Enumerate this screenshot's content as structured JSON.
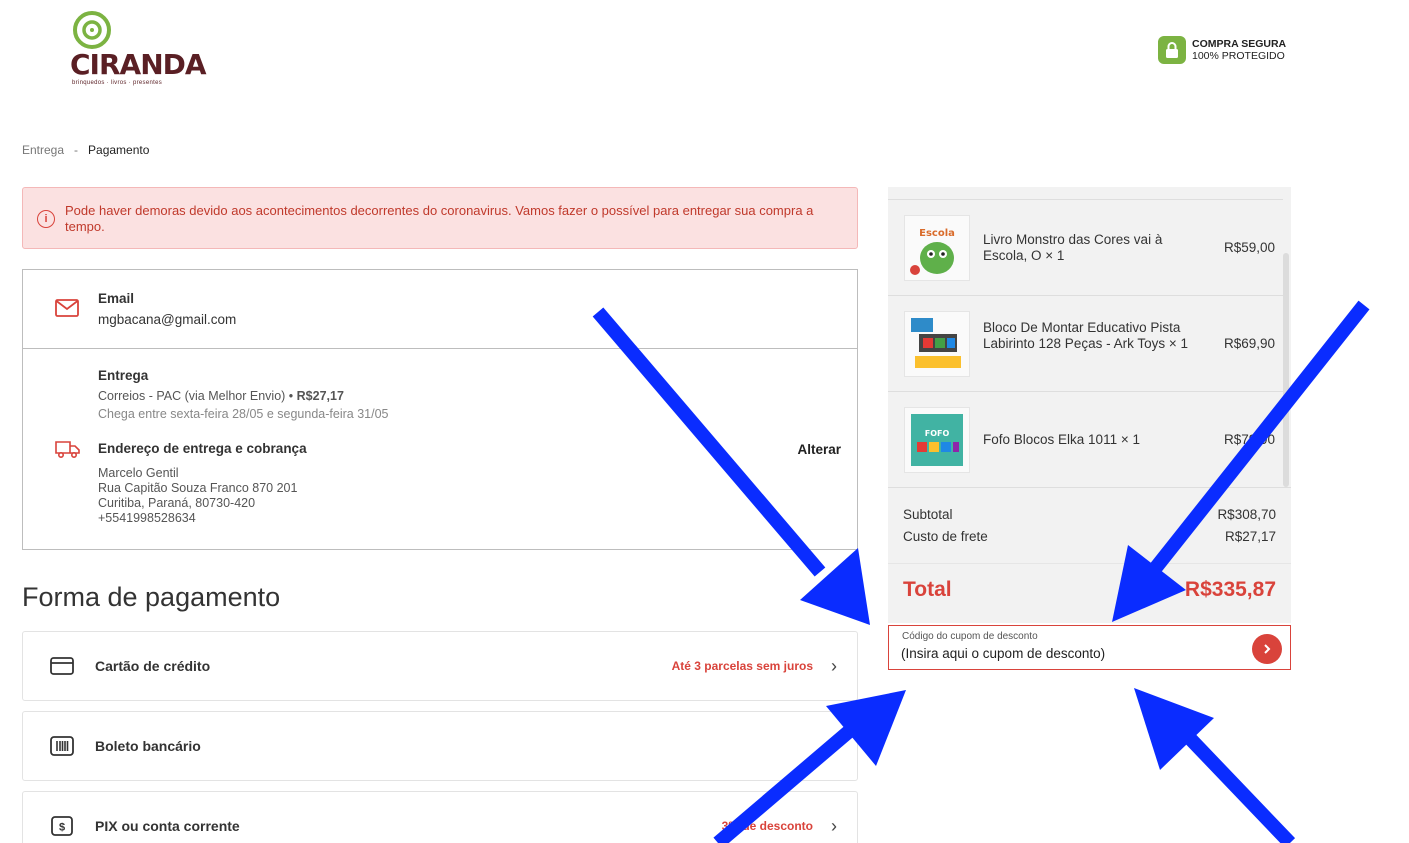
{
  "brand": {
    "name": "CIRANDA",
    "tagline": "brinquedos · livros · presentes"
  },
  "secure": {
    "title": "COMPRA SEGURA",
    "subtitle": "100% PROTEGIDO"
  },
  "breadcrumb": {
    "step1": "Entrega",
    "separator": "-",
    "step2": "Pagamento"
  },
  "alert": {
    "text": "Pode haver demoras devido aos acontecimentos decorrentes do coronavirus. Vamos fazer o possível para entregar sua compra a tempo."
  },
  "contact": {
    "label": "Email",
    "value": "mgbacana@gmail.com"
  },
  "shipping": {
    "label": "Entrega",
    "method": "Correios - PAC (via Melhor Envio) •",
    "price": "R$27,17",
    "eta": "Chega entre sexta-feira 28/05 e segunda-feira 31/05"
  },
  "address": {
    "label": "Endereço de entrega e cobrança",
    "name": "Marcelo Gentil",
    "street": "Rua Capitão Souza Franco 870 201",
    "city": "Curitiba, Paraná, 80730-420",
    "phone": "+5541998528634",
    "change_label": "Alterar"
  },
  "payment": {
    "title": "Forma de pagamento",
    "options": [
      {
        "label": "Cartão de crédito",
        "note": "Até 3 parcelas sem juros",
        "icon": "credit-card-icon"
      },
      {
        "label": "Boleto bancário",
        "note": "",
        "icon": "barcode-icon"
      },
      {
        "label": "PIX ou conta corrente",
        "note": "3% de desconto",
        "icon": "dollar-icon"
      }
    ]
  },
  "cart": {
    "items": [
      {
        "name": "Livro Monstro das Cores vai à Escola, O × 1",
        "price": "R$59,00"
      },
      {
        "name": "Bloco De Montar Educativo Pista Labirinto 128 Peças - Ark Toys × 1",
        "price": "R$69,90"
      },
      {
        "name": "Fofo Blocos Elka 1011 × 1",
        "price": "R$79,90"
      }
    ],
    "subtotal_label": "Subtotal",
    "subtotal": "R$308,70",
    "shipping_label": "Custo de frete",
    "shipping": "R$27,17",
    "total_label": "Total",
    "total": "R$335,87"
  },
  "coupon": {
    "label": "Código do cupom de desconto",
    "value": "(Insira aqui o cupom de desconto)"
  },
  "colors": {
    "accent": "#d9433b",
    "annotation": "#0a2cff",
    "secure": "#7cb342"
  }
}
